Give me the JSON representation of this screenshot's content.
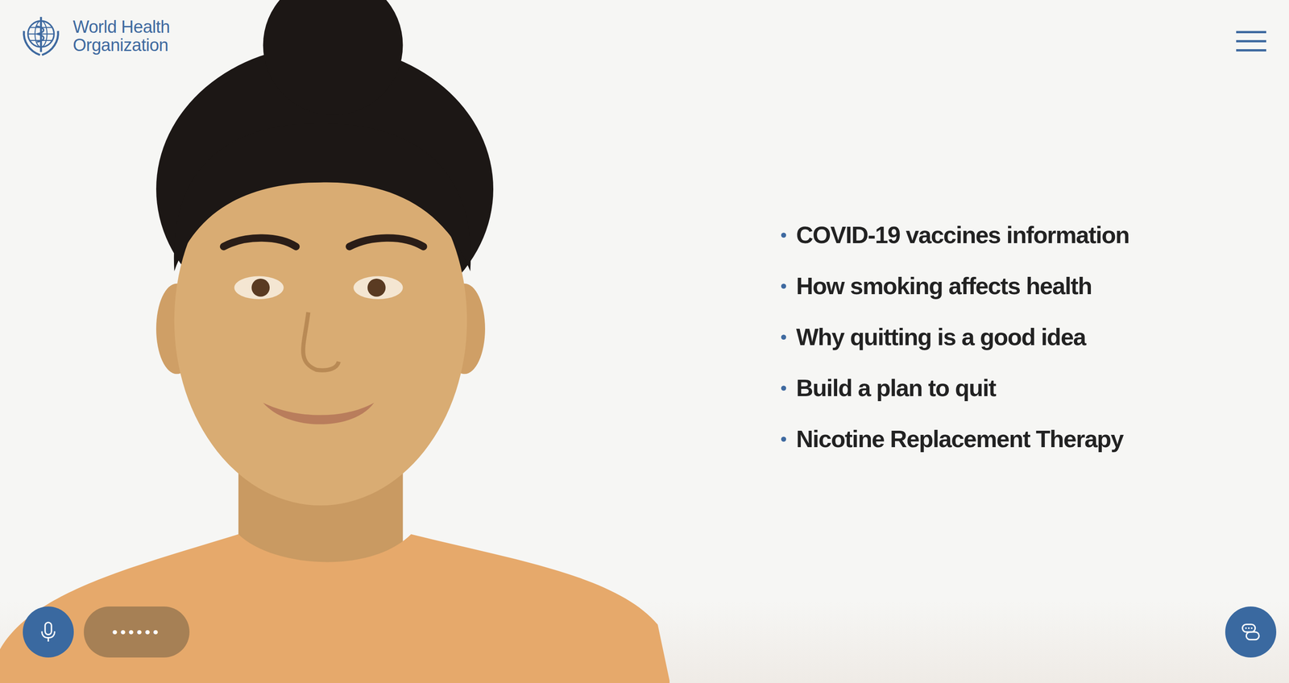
{
  "logo": {
    "line1": "World Health",
    "line2": "Organization"
  },
  "topics": [
    {
      "label": "COVID-19 vaccines information"
    },
    {
      "label": "How smoking affects health"
    },
    {
      "label": "Why quitting is a good idea"
    },
    {
      "label": "Build a plan to quit"
    },
    {
      "label": "Nicotine Replacement Therapy"
    }
  ],
  "voice_input": {
    "indicator": "••••••"
  }
}
